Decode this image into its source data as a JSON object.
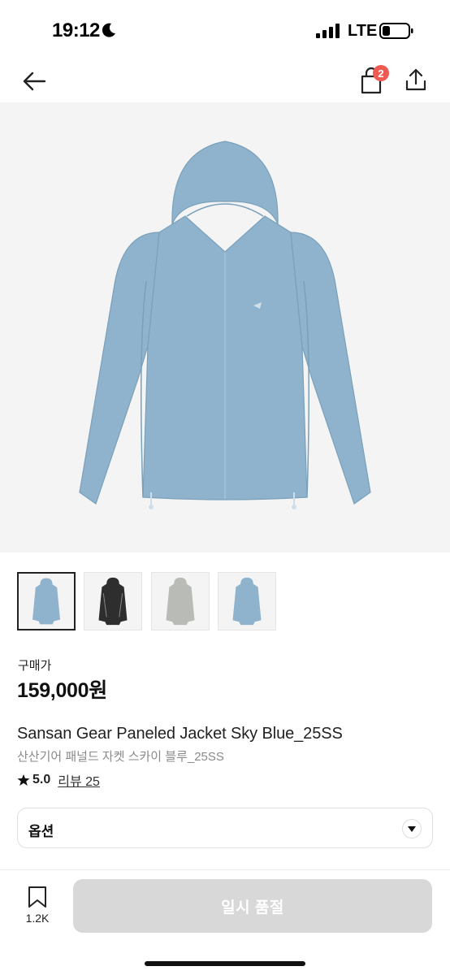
{
  "status_bar": {
    "time": "19:12",
    "carrier": "LTE",
    "icons": [
      "moon-icon",
      "signal-icon",
      "battery-icon"
    ]
  },
  "header": {
    "icons": [
      "arrow-left-icon",
      "shopping-bag-icon",
      "share-icon"
    ],
    "cart_count": "2",
    "badge_color": "#ef5a52"
  },
  "product": {
    "image_color": "#8fb3cc",
    "thumbnails": [
      {
        "color": "#8fb3cc",
        "selected": true
      },
      {
        "color": "#2e2e2e",
        "selected": false
      },
      {
        "color": "#b9bbb6",
        "selected": false
      },
      {
        "color": "#8fb3cc",
        "selected": false
      }
    ],
    "price_label": "구매가",
    "price": "159,000원",
    "title_en": "Sansan Gear Paneled Jacket Sky Blue_25SS",
    "title_ko": "산산기어 패널드 자켓 스카이 블루_25SS",
    "rating": "5.0",
    "review_label": "리뷰 25"
  },
  "option": {
    "label": "옵션",
    "icon": "chevron-down-icon"
  },
  "bottom_bar": {
    "bookmark_icon": "bookmark-icon",
    "bookmark_count": "1.2K",
    "buy_button_label": "일시 품절",
    "buy_button_color": "#d8d8d8"
  }
}
